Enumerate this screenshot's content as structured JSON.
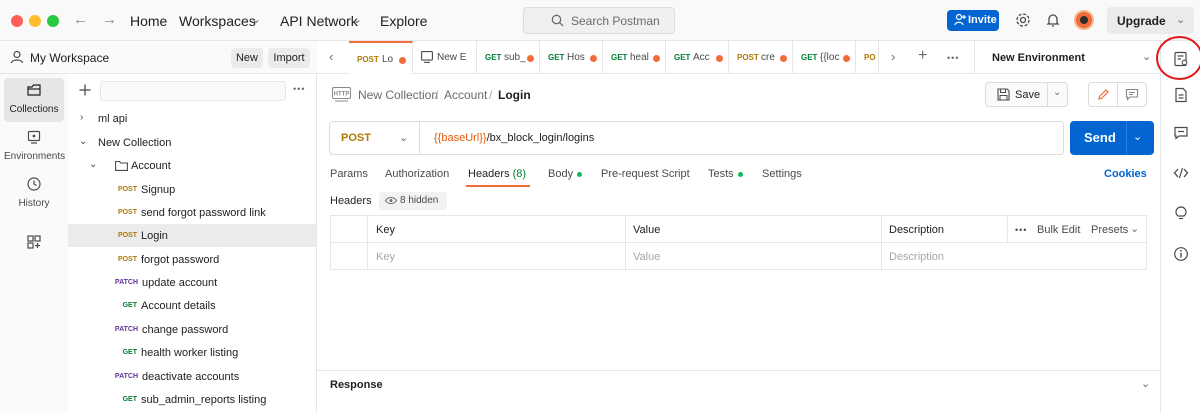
{
  "titlebar": {
    "nav_back": "←",
    "nav_forward": "→",
    "home": "Home",
    "workspaces": "Workspaces",
    "api_network": "API Network",
    "explore": "Explore",
    "search_placeholder": "Search Postman",
    "invite": "Invite",
    "upgrade": "Upgrade",
    "caret": "⌄"
  },
  "workspace": {
    "title": "My Workspace",
    "new_label": "New",
    "import_label": "Import"
  },
  "rail": {
    "items": [
      {
        "label": "Collections",
        "icon": "collections-icon"
      },
      {
        "label": "Environments",
        "icon": "environments-icon"
      },
      {
        "label": "History",
        "icon": "history-icon"
      },
      {
        "label": "",
        "icon": "add-modules-icon"
      }
    ]
  },
  "sidebar": {
    "more": "•••",
    "tree": [
      {
        "label": "ml api",
        "kind": "collection",
        "expanded": false
      },
      {
        "label": "New Collection",
        "kind": "collection",
        "expanded": true
      },
      {
        "label": "Account",
        "kind": "folder",
        "expanded": true
      },
      {
        "method": "POST",
        "label": "Signup"
      },
      {
        "method": "POST",
        "label": "send forgot password link"
      },
      {
        "method": "POST",
        "label": "Login",
        "selected": true
      },
      {
        "method": "POST",
        "label": "forgot password"
      },
      {
        "method": "PATCH",
        "label": "update account"
      },
      {
        "method": "GET",
        "label": "Account details"
      },
      {
        "method": "PATCH",
        "label": "change password"
      },
      {
        "method": "GET",
        "label": "health worker listing"
      },
      {
        "method": "PATCH",
        "label": "deactivate accounts"
      },
      {
        "method": "GET",
        "label": "sub_admin_reports listing"
      }
    ]
  },
  "tabs": {
    "prev": "‹",
    "next": "›",
    "add": "+",
    "more": "•••",
    "items": [
      {
        "method": "POST",
        "name": "Lo",
        "dirty": true,
        "active": true
      },
      {
        "method": "",
        "name": "New E",
        "dirty": false
      },
      {
        "method": "GET",
        "name": "sub_",
        "dirty": true
      },
      {
        "method": "GET",
        "name": "Hos",
        "dirty": true
      },
      {
        "method": "GET",
        "name": "heal",
        "dirty": true
      },
      {
        "method": "GET",
        "name": "Acc",
        "dirty": true
      },
      {
        "method": "POST",
        "name": "cre",
        "dirty": true
      },
      {
        "method": "GET",
        "name": "{{loc",
        "dirty": true
      },
      {
        "method": "PO",
        "name": "",
        "dirty": false
      }
    ],
    "environment": "New Environment"
  },
  "request": {
    "breadcrumb": {
      "collection": "New Collection",
      "folder": "Account",
      "name": "Login",
      "sep": "/"
    },
    "save_label": "Save",
    "method": "POST",
    "url_var": "{{baseUrl}}",
    "url_path": "/bx_block_login/logins",
    "send_label": "Send",
    "tabs": [
      {
        "label": "Params"
      },
      {
        "label": "Authorization"
      },
      {
        "label": "Headers",
        "count": "(8)"
      },
      {
        "label": "Body",
        "dot": true
      },
      {
        "label": "Pre-request Script"
      },
      {
        "label": "Tests",
        "dot": true
      },
      {
        "label": "Settings"
      }
    ],
    "cookies": "Cookies",
    "headers_title": "Headers",
    "hidden_label": "8 hidden",
    "table": {
      "key": "Key",
      "value": "Value",
      "description": "Description",
      "bulk_edit": "Bulk Edit",
      "presets": "Presets",
      "more": "•••",
      "key_placeholder": "Key",
      "value_placeholder": "Value",
      "description_placeholder": "Description"
    }
  },
  "response": {
    "title": "Response"
  },
  "colors": {
    "accent": "#f06d3b",
    "primary": "#0265d2",
    "post": "#ad7a03",
    "get": "#007f31",
    "patch": "#623497",
    "annotation_circle": "#e01b1b"
  }
}
